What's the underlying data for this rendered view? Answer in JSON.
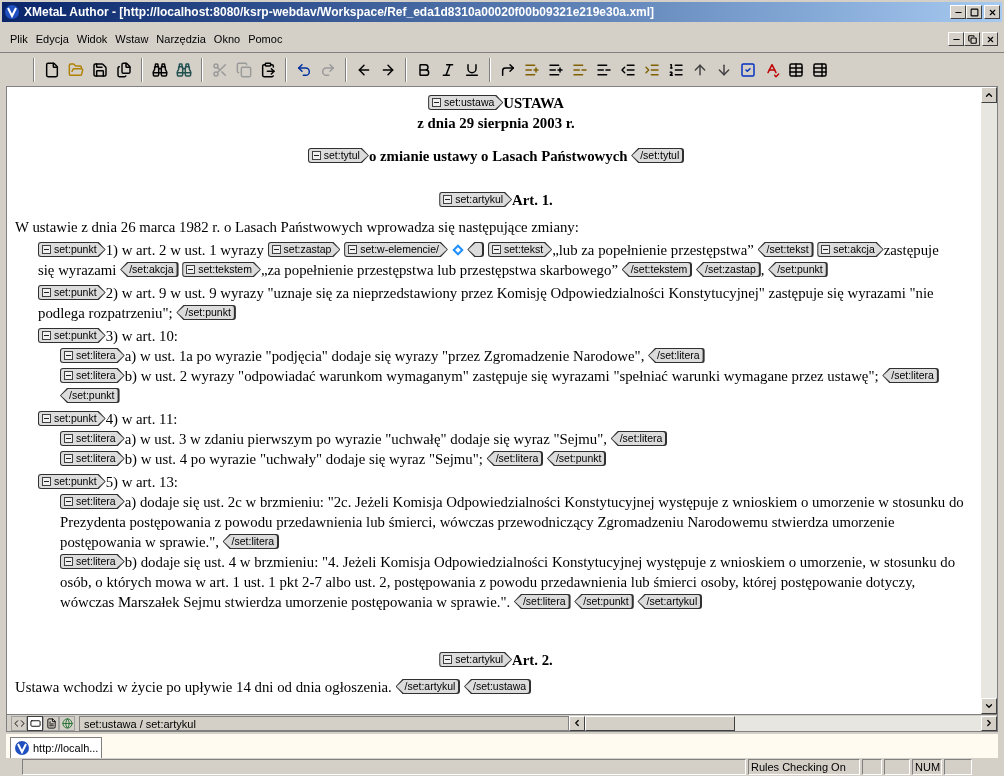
{
  "window": {
    "title": "XMetaL Author - [http://localhost:8080/ksrp-webdav/Workspace/Ref_eda1d8310a00020f00b09321e219e30a.xml]"
  },
  "menu": [
    "Plik",
    "Edycja",
    "Widok",
    "Wstaw",
    "Narzędzia",
    "Okno",
    "Pomoc"
  ],
  "toolbar": [
    [
      {
        "kind": "new",
        "disabled": false
      },
      {
        "kind": "open",
        "disabled": false
      },
      {
        "kind": "save",
        "disabled": false
      },
      {
        "kind": "save-all",
        "disabled": false
      }
    ],
    [
      {
        "kind": "find",
        "disabled": false
      },
      {
        "kind": "replace",
        "disabled": false
      }
    ],
    [
      {
        "kind": "cut",
        "disabled": true
      },
      {
        "kind": "copy",
        "disabled": true
      },
      {
        "kind": "paste",
        "disabled": false
      }
    ],
    [
      {
        "kind": "undo",
        "disabled": false
      },
      {
        "kind": "redo",
        "disabled": true
      }
    ],
    [
      {
        "kind": "back",
        "disabled": false
      },
      {
        "kind": "forward",
        "disabled": false
      }
    ],
    [
      {
        "kind": "bold",
        "disabled": false
      },
      {
        "kind": "italic",
        "disabled": false
      },
      {
        "kind": "underline",
        "disabled": false
      }
    ],
    [
      {
        "kind": "insert",
        "disabled": false
      },
      {
        "kind": "add-section",
        "disabled": false
      },
      {
        "kind": "add-list",
        "disabled": false
      },
      {
        "kind": "remove-section",
        "disabled": false
      },
      {
        "kind": "remove-list",
        "disabled": false
      },
      {
        "kind": "remove-item",
        "disabled": false
      },
      {
        "kind": "split-section",
        "disabled": false
      },
      {
        "kind": "split-list",
        "disabled": false
      },
      {
        "kind": "move-up",
        "disabled": false
      },
      {
        "kind": "move-down",
        "disabled": false
      },
      {
        "kind": "validate",
        "disabled": false
      },
      {
        "kind": "spell",
        "disabled": false
      },
      {
        "kind": "table",
        "disabled": false
      },
      {
        "kind": "table-cell",
        "disabled": false
      }
    ]
  ],
  "document": [
    {
      "kind": "heading",
      "segments": [
        {
          "kind": "open",
          "label": "set:ustawa"
        },
        {
          "kind": "text",
          "text": "USTAWA"
        }
      ]
    },
    {
      "kind": "heading",
      "segments": [
        {
          "kind": "text",
          "text": "z dnia 29 sierpnia 2003 r."
        }
      ]
    },
    {
      "kind": "title",
      "segments": [
        {
          "kind": "open",
          "label": "set:tytul"
        },
        {
          "kind": "text",
          "text": "o zmianie ustawy o Lasach Państwowych"
        },
        {
          "kind": "close",
          "label": "/set:tytul"
        }
      ]
    },
    {
      "kind": "article",
      "segments": [
        {
          "kind": "open",
          "label": "set:artykul"
        },
        {
          "kind": "text",
          "text": "Art. 1."
        }
      ]
    },
    {
      "kind": "para",
      "segments": [
        {
          "kind": "text",
          "text": "W ustawie z dnia 26 marca 1982 r. o Lasach Państwowych wprowadza się następujące zmiany:"
        }
      ],
      "children": [
        {
          "kind": "para",
          "segments": [
            {
              "kind": "open",
              "label": "set:punkt"
            },
            {
              "kind": "text",
              "text": "1) w art. 2 w ust. 1 wyrazy"
            },
            {
              "kind": "open",
              "label": "set:zastap"
            },
            {
              "kind": "open",
              "label": "set:w-elemencie/"
            },
            {
              "kind": "diamond"
            },
            {
              "kind": "stub"
            },
            {
              "kind": "open",
              "label": "set:tekst"
            },
            {
              "kind": "text",
              "text": "„lub za popełnienie przestępstwa”"
            },
            {
              "kind": "close",
              "label": "/set:tekst"
            },
            {
              "kind": "open",
              "label": "set:akcja"
            },
            {
              "kind": "text",
              "text": "zastępuje"
            },
            {
              "kind": "text",
              "text": "się wyrazami"
            },
            {
              "kind": "close",
              "label": "/set:akcja"
            },
            {
              "kind": "open",
              "label": "set:tekstem"
            },
            {
              "kind": "text",
              "text": "„za popełnienie przestępstwa lub przestępstwa skarbowego”"
            },
            {
              "kind": "close",
              "label": "/set:tekstem"
            },
            {
              "kind": "close",
              "label": "/set:zastap"
            },
            {
              "kind": "text",
              "text": ","
            },
            {
              "kind": "close",
              "label": "/set:punkt"
            }
          ]
        },
        {
          "kind": "para",
          "segments": [
            {
              "kind": "open",
              "label": "set:punkt"
            },
            {
              "kind": "text",
              "text": "2) w art. 9 w ust. 9 wyrazy \"uznaje się za nieprzedstawiony przez Komisję Odpowiedzialności Konstytucyjnej\" zastępuje się wyrazami \"nie"
            },
            {
              "kind": "text",
              "text": "podlega rozpatrzeniu\";"
            },
            {
              "kind": "close",
              "label": "/set:punkt"
            }
          ]
        },
        {
          "kind": "para",
          "segments": [
            {
              "kind": "open",
              "label": "set:punkt"
            },
            {
              "kind": "text",
              "text": "3) w art. 10:"
            }
          ],
          "children": [
            {
              "kind": "line",
              "segments": [
                {
                  "kind": "open",
                  "label": "set:litera"
                },
                {
                  "kind": "text",
                  "text": "a) w ust. 1a po wyrazie \"podjęcia\" dodaje się wyrazy \"przez Zgromadzenie Narodowe\","
                },
                {
                  "kind": "close",
                  "label": "/set:litera"
                }
              ]
            },
            {
              "kind": "line",
              "segments": [
                {
                  "kind": "open",
                  "label": "set:litera"
                },
                {
                  "kind": "text",
                  "text": "b) w ust. 2 wyrazy \"odpowiadać warunkom wymaganym\" zastępuje się wyrazami \"spełniać warunki wymagane przez ustawę\";"
                },
                {
                  "kind": "close",
                  "label": "/set:litera"
                },
                {
                  "kind": "close",
                  "label": "/set:punkt"
                }
              ]
            }
          ]
        },
        {
          "kind": "para",
          "segments": [
            {
              "kind": "open",
              "label": "set:punkt"
            },
            {
              "kind": "text",
              "text": "4) w art. 11:"
            }
          ],
          "children": [
            {
              "kind": "line",
              "segments": [
                {
                  "kind": "open",
                  "label": "set:litera"
                },
                {
                  "kind": "text",
                  "text": "a) w ust. 3 w zdaniu pierwszym po wyrazie \"uchwałę\" dodaje się wyraz \"Sejmu\","
                },
                {
                  "kind": "close",
                  "label": "/set:litera"
                }
              ]
            },
            {
              "kind": "line",
              "segments": [
                {
                  "kind": "open",
                  "label": "set:litera"
                },
                {
                  "kind": "text",
                  "text": "b) w ust. 4 po wyrazie \"uchwały\" dodaje się wyraz \"Sejmu\";"
                },
                {
                  "kind": "close",
                  "label": "/set:litera"
                },
                {
                  "kind": "close",
                  "label": "/set:punkt"
                }
              ]
            }
          ]
        },
        {
          "kind": "para",
          "segments": [
            {
              "kind": "open",
              "label": "set:punkt"
            },
            {
              "kind": "text",
              "text": "5) w art. 13:"
            }
          ],
          "children": [
            {
              "kind": "line",
              "segments": [
                {
                  "kind": "open",
                  "label": "set:litera"
                },
                {
                  "kind": "text",
                  "text": "a) dodaje się ust. 2c w brzmieniu: \"2c. Jeżeli Komisja Odpowiedzialności Konstytucyjnej występuje z wnioskiem o umorzenie w stosunku do"
                },
                {
                  "kind": "text",
                  "text": "Prezydenta postępowania z powodu przedawnienia lub śmierci, wówczas przewodniczący Zgromadzeniu Narodowemu stwierdza umorzenie"
                },
                {
                  "kind": "text",
                  "text": "postępowania w sprawie.\","
                },
                {
                  "kind": "close",
                  "label": "/set:litera"
                }
              ]
            },
            {
              "kind": "line",
              "segments": [
                {
                  "kind": "open",
                  "label": "set:litera"
                },
                {
                  "kind": "text",
                  "text": "b) dodaje się ust. 4 w brzmieniu: \"4. Jeżeli Komisja Odpowiedzialności Konstytucyjnej występuje z wnioskiem o umorzenie, w stosunku do"
                },
                {
                  "kind": "text",
                  "text": "osób, o których mowa w art. 1 ust. 1 pkt 2-7 albo ust. 2, postępowania z powodu przedawnienia lub śmierci osoby, której postępowanie dotyczy,"
                },
                {
                  "kind": "text",
                  "text": "wówczas Marszałek Sejmu stwierdza umorzenie postępowania w sprawie.\"."
                },
                {
                  "kind": "close",
                  "label": "/set:litera"
                },
                {
                  "kind": "close",
                  "label": "/set:punkt"
                },
                {
                  "kind": "close",
                  "label": "/set:artykul"
                }
              ]
            }
          ]
        }
      ]
    },
    {
      "kind": "article2",
      "segments": [
        {
          "kind": "open",
          "label": "set:artykul"
        },
        {
          "kind": "text",
          "text": "Art. 2."
        }
      ]
    },
    {
      "kind": "para",
      "segments": [
        {
          "kind": "text",
          "text": "Ustawa wchodzi w życie po upływie 14 dni od dnia ogłoszenia."
        },
        {
          "kind": "close",
          "label": "/set:artykul"
        },
        {
          "kind": "close",
          "label": "/set:ustawa"
        }
      ]
    }
  ],
  "view_tabs": [
    {
      "kind": "tags",
      "selected": false
    },
    {
      "kind": "normal",
      "selected": true
    },
    {
      "kind": "page",
      "selected": false
    },
    {
      "kind": "browser",
      "selected": false
    }
  ],
  "element_path": "set:ustawa / set:artykul",
  "taskbar": [
    {
      "label": "http://localh...",
      "selected": true
    }
  ],
  "status_bar": {
    "rules": "Rules Checking On",
    "num": "NUM"
  }
}
